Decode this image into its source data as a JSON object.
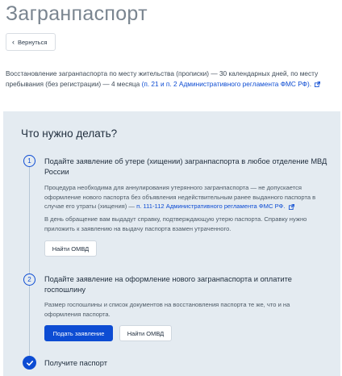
{
  "page": {
    "title": "Загранпаспорт",
    "back_label": "Вернуться"
  },
  "intro": {
    "text": "Восстановление загранпаспорта по месту жительства (прописки) — 30 календарных дней, по месту пребывания (без регистрации) — 4 месяца ",
    "link": "(п. 21 и п. 2 Административного регламента ФМС РФ)",
    "tail": "."
  },
  "panel": {
    "title": "Что нужно делать?"
  },
  "steps": [
    {
      "number": "1",
      "title": "Подайте заявление об утере (хищении) загранпаспорта в любое отделение МВД России",
      "text1": "Процедура необходима для аннулирования утерянного загранпаспорта — не допускается оформление нового паспорта без объявления недействительным ранее выданного паспорта в случае его утраты (хищения) — ",
      "text1_link": "п. 111-112 Административного регламента ФМС РФ.",
      "text2": "В день обращение вам выдадут справку, подтверждающую утерю паспорта. Справку нужно приложить к заявлению на выдачу паспорта взамен утраченного.",
      "button": "Найти ОМВД"
    },
    {
      "number": "2",
      "title": "Подайте заявление на оформление нового загранпаспорта и оплатите госпошлину",
      "text": "Размер госпошлины и список документов на восстановления паспорта те же, что и на оформления паспорта.",
      "primary_button": "Подать заявление",
      "secondary_button": "Найти ОМВД"
    },
    {
      "title": "Получите паспорт"
    }
  ],
  "colors": {
    "accent": "#0d4cd3",
    "panel_bg": "#e4ebf1"
  }
}
